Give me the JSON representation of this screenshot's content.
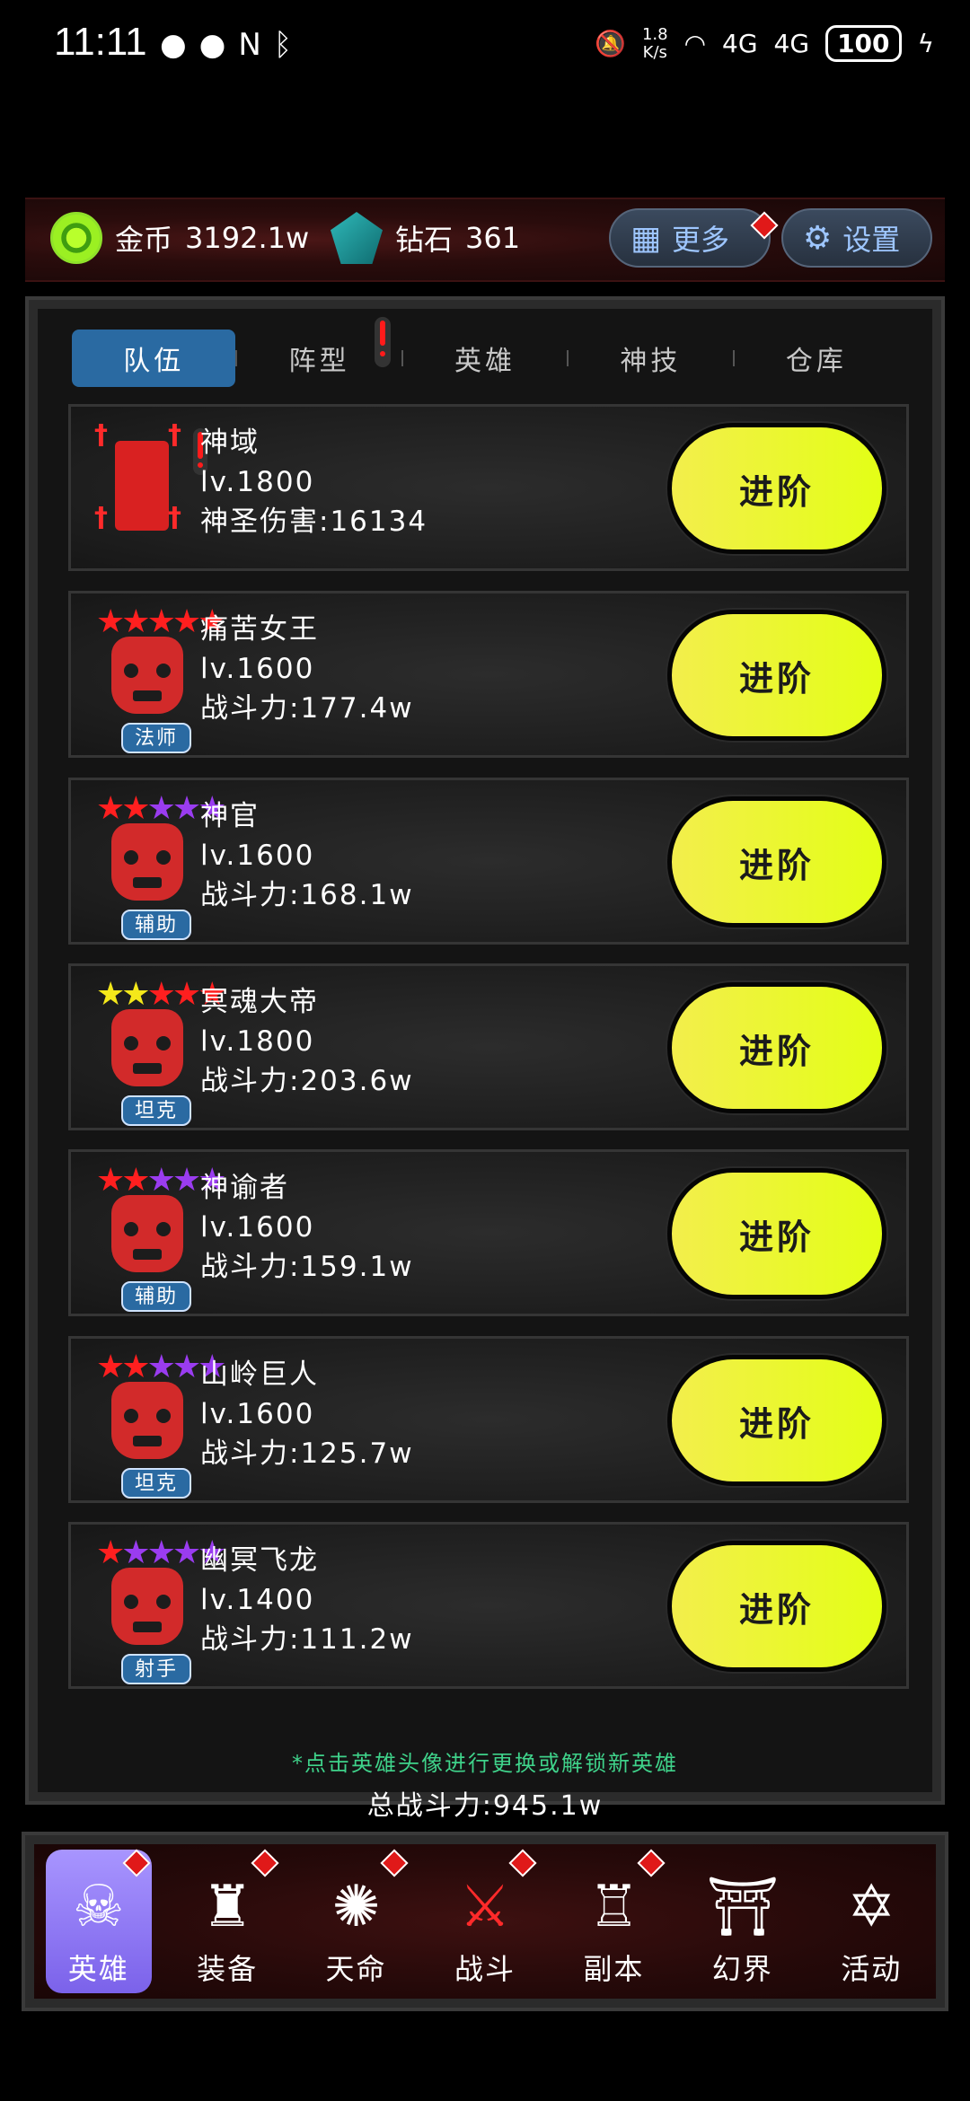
{
  "status_bar": {
    "time": "11:11",
    "speed_top": "1.8",
    "speed_bottom": "K/s",
    "network1": "4G",
    "network2": "4G",
    "battery": "100"
  },
  "resources": {
    "gold_label": "金币",
    "gold_value": "3192.1w",
    "diamond_label": "钻石",
    "diamond_value": "361",
    "more_label": "更多",
    "settings_label": "设置"
  },
  "tabs": [
    {
      "label": "队伍",
      "active": true
    },
    {
      "label": "阵型",
      "active": false
    },
    {
      "label": "英雄",
      "active": false
    },
    {
      "label": "神技",
      "active": false
    },
    {
      "label": "仓库",
      "active": false
    }
  ],
  "heroes": [
    {
      "name": "神域",
      "level": "lv.1800",
      "stat": "神圣伤害:16134",
      "role": "",
      "stars": [],
      "button": "进阶"
    },
    {
      "name": "痛苦女王",
      "level": "lv.1600",
      "stat": "战斗力:177.4w",
      "role": "法师",
      "stars": [
        "red",
        "red",
        "red",
        "red",
        "red"
      ],
      "button": "进阶"
    },
    {
      "name": "神官",
      "level": "lv.1600",
      "stat": "战斗力:168.1w",
      "role": "辅助",
      "stars": [
        "red",
        "red",
        "purple",
        "purple",
        "purple"
      ],
      "button": "进阶"
    },
    {
      "name": "冥魂大帝",
      "level": "lv.1800",
      "stat": "战斗力:203.6w",
      "role": "坦克",
      "stars": [
        "yellow",
        "yellow",
        "red",
        "red",
        "red"
      ],
      "button": "进阶"
    },
    {
      "name": "神谕者",
      "level": "lv.1600",
      "stat": "战斗力:159.1w",
      "role": "辅助",
      "stars": [
        "red",
        "red",
        "purple",
        "purple",
        "purple"
      ],
      "button": "进阶"
    },
    {
      "name": "山岭巨人",
      "level": "lv.1600",
      "stat": "战斗力:125.7w",
      "role": "坦克",
      "stars": [
        "red",
        "red",
        "purple",
        "purple",
        "purple"
      ],
      "button": "进阶"
    },
    {
      "name": "幽冥飞龙",
      "level": "lv.1400",
      "stat": "战斗力:111.2w",
      "role": "射手",
      "stars": [
        "red",
        "purple",
        "purple",
        "purple",
        "purple"
      ],
      "button": "进阶"
    }
  ],
  "hint": "*点击英雄头像进行更换或解锁新英雄",
  "total_power": "总战斗力:945.1w",
  "bottom_nav": [
    {
      "label": "英雄",
      "icon": "skull-icon",
      "active": true,
      "badge": true
    },
    {
      "label": "装备",
      "icon": "armor-icon",
      "active": false,
      "badge": true
    },
    {
      "label": "天命",
      "icon": "mandala-icon",
      "active": false,
      "badge": true
    },
    {
      "label": "战斗",
      "icon": "crossed-swords-icon",
      "active": false,
      "badge": true
    },
    {
      "label": "副本",
      "icon": "castle-icon",
      "active": false,
      "badge": true
    },
    {
      "label": "幻界",
      "icon": "gate-icon",
      "active": false,
      "badge": false
    },
    {
      "label": "活动",
      "icon": "scroll-icon",
      "active": false,
      "badge": false
    }
  ],
  "colors": {
    "accent_blue": "#2a6aa2",
    "advance_yellow": "#e8f52a",
    "star_red": "#ff1f1f",
    "star_purple": "#9a3cf0",
    "star_yellow": "#f4e81a",
    "hint_green": "#3fd28a"
  }
}
